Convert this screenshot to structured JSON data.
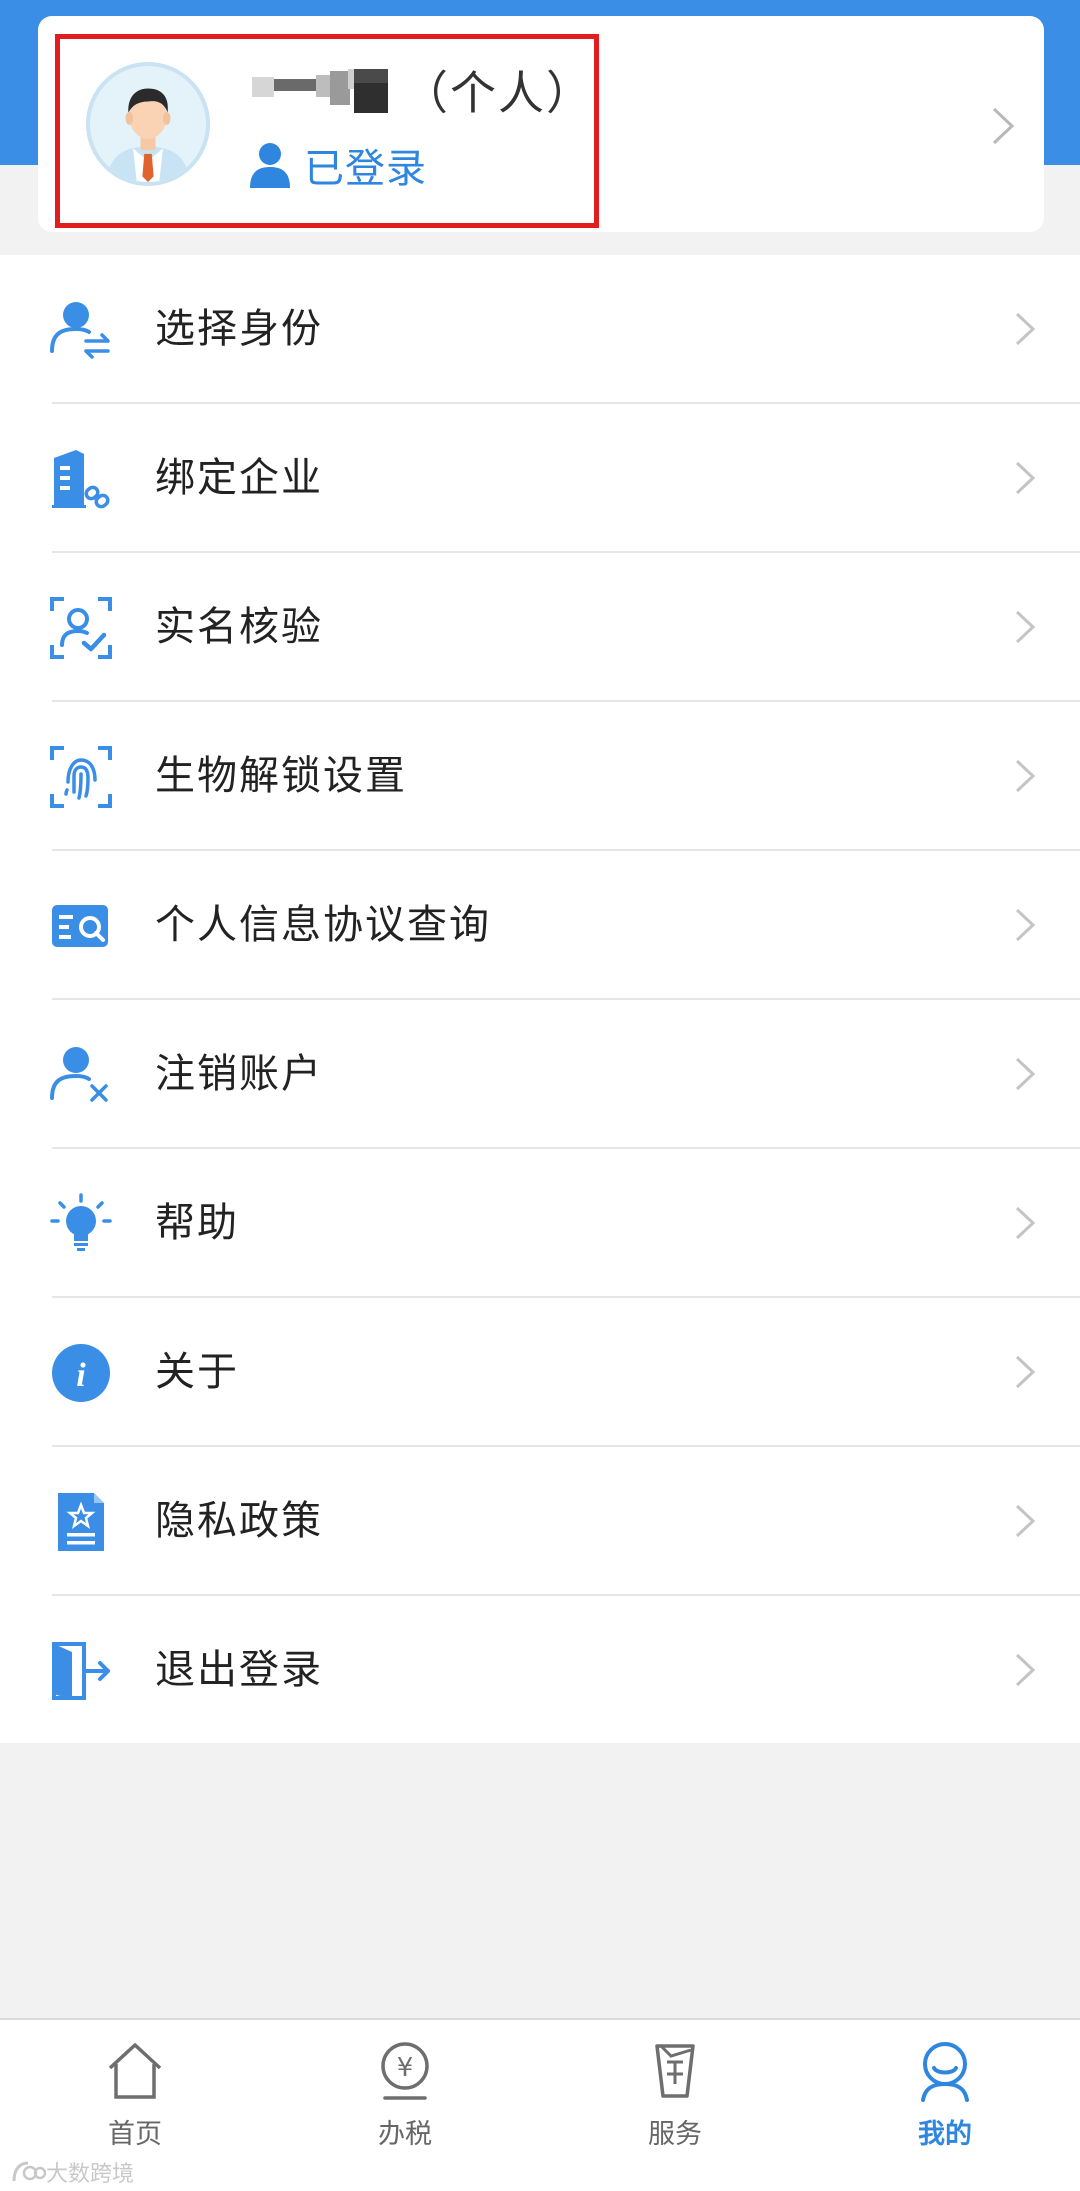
{
  "profile": {
    "name_suffix": "（个人）",
    "login_status": "已登录"
  },
  "menu": {
    "items": [
      {
        "label": "选择身份",
        "icon": "switch-identity-icon"
      },
      {
        "label": "绑定企业",
        "icon": "bind-enterprise-icon"
      },
      {
        "label": "实名核验",
        "icon": "face-verify-icon"
      },
      {
        "label": "生物解锁设置",
        "icon": "fingerprint-icon"
      },
      {
        "label": "个人信息协议查询",
        "icon": "agreement-search-icon"
      },
      {
        "label": "注销账户",
        "icon": "cancel-account-icon"
      },
      {
        "label": "帮助",
        "icon": "lightbulb-icon"
      },
      {
        "label": "关于",
        "icon": "info-icon"
      },
      {
        "label": "隐私政策",
        "icon": "privacy-document-icon"
      },
      {
        "label": "退出登录",
        "icon": "logout-icon"
      }
    ]
  },
  "bottom_nav": {
    "items": [
      {
        "label": "首页",
        "icon": "home-icon"
      },
      {
        "label": "办税",
        "icon": "tax-icon"
      },
      {
        "label": "服务",
        "icon": "service-icon"
      },
      {
        "label": "我的",
        "icon": "profile-icon",
        "active": true
      }
    ]
  },
  "watermark": {
    "text": "大数跨境"
  },
  "colors": {
    "brand_blue": "#3a8ee6",
    "link_blue": "#2e86de",
    "highlight_red": "#e21d1d"
  }
}
